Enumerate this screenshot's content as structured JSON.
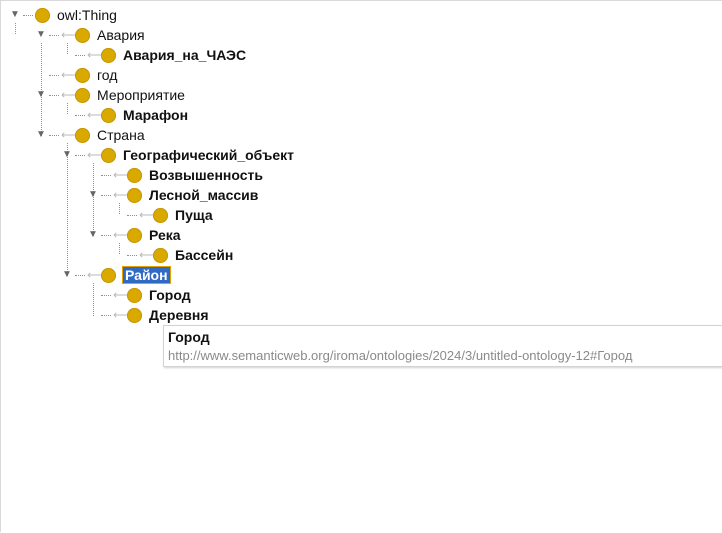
{
  "tree": {
    "root": {
      "label": "owl:Thing",
      "bold": false
    },
    "items": [
      {
        "label": "Авария",
        "bold": false
      },
      {
        "label": "Авария_на_ЧАЭС",
        "bold": true
      },
      {
        "label": "год",
        "bold": false
      },
      {
        "label": "Мероприятие",
        "bold": false
      },
      {
        "label": "Марафон",
        "bold": true
      },
      {
        "label": "Страна",
        "bold": false
      },
      {
        "label": "Географический_объект",
        "bold": true
      },
      {
        "label": "Возвышенность",
        "bold": true
      },
      {
        "label": "Лесной_массив",
        "bold": true
      },
      {
        "label": "Пуща",
        "bold": true
      },
      {
        "label": "Река",
        "bold": true
      },
      {
        "label": "Бассейн",
        "bold": true
      },
      {
        "label": "Район",
        "bold": true,
        "selected": true
      },
      {
        "label": "Город",
        "bold": true
      },
      {
        "label": "Деревня",
        "bold": true
      }
    ]
  },
  "tooltip": {
    "title": "Город",
    "iri": "http://www.semanticweb.org/iroma/ontologies/2024/3/untitled-ontology-12#Город"
  },
  "colors": {
    "class_dot": "#d9a900",
    "selection": "#316ac5",
    "selection_border": "#e2a100"
  }
}
